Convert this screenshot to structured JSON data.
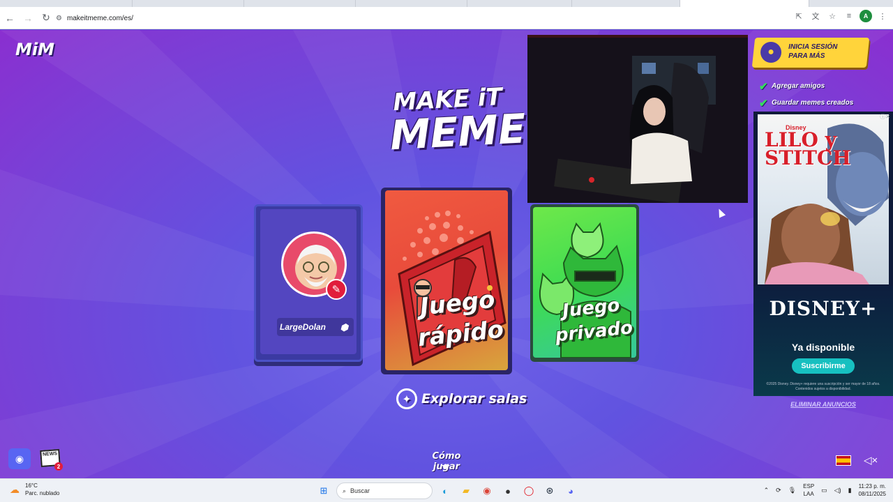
{
  "browser": {
    "url": "makeitmeme.com/es/",
    "icons": [
      "back-arrow-icon",
      "forward-arrow-icon",
      "reload-icon",
      "site-info-icon",
      "install-icon",
      "translate-icon",
      "bookmark-star-icon",
      "tab-search-icon",
      "profile-avatar-icon",
      "menu-dots-icon"
    ],
    "profile_initial": "A"
  },
  "game": {
    "small_logo": "MiM",
    "main_logo_line1": "MAKE iT",
    "main_logo_line2": "MEME",
    "profile": {
      "username": "LargeDolan"
    },
    "quick_play": {
      "title": "Juego rápido"
    },
    "private_game": {
      "title": "Juego privado"
    },
    "explore_rooms": "Explorar salas",
    "how_to_play": "Cómo jugar",
    "news_label": "NEWS",
    "news_badge": "2",
    "colors": {
      "accent": "#ffd43b",
      "quick_card": "#e84b3b",
      "private_card": "#3fdc52",
      "background": "#6153e0"
    }
  },
  "sidebar": {
    "login_line1": "INICIA SESIÓN",
    "login_line2": "PARA MÁS",
    "perks": [
      {
        "label": "Agregar amigos",
        "icon": "check-icon"
      },
      {
        "label": "Guardar memes creados",
        "icon": "check-icon"
      }
    ],
    "remove_ads": "ELIMINAR ANUNCIOS"
  },
  "ad": {
    "studio": "Disney",
    "movie_title_line1": "LILO y",
    "movie_title_line2": "STITCH",
    "brand": "DISNEY+",
    "available": "Ya disponible",
    "subscribe": "Suscribirme",
    "legal": "©2025 Disney. Disney+ requiere una suscripción y ser mayor de 18 años. Contenidos sujetos a disponibilidad."
  },
  "taskbar": {
    "temperature": "16°C",
    "weather_desc": "Parc. nublado",
    "search_placeholder": "Buscar",
    "lang_line1": "ESP",
    "lang_line2": "LAA",
    "time": "11:23 p. m.",
    "date": "08/11/2025"
  }
}
